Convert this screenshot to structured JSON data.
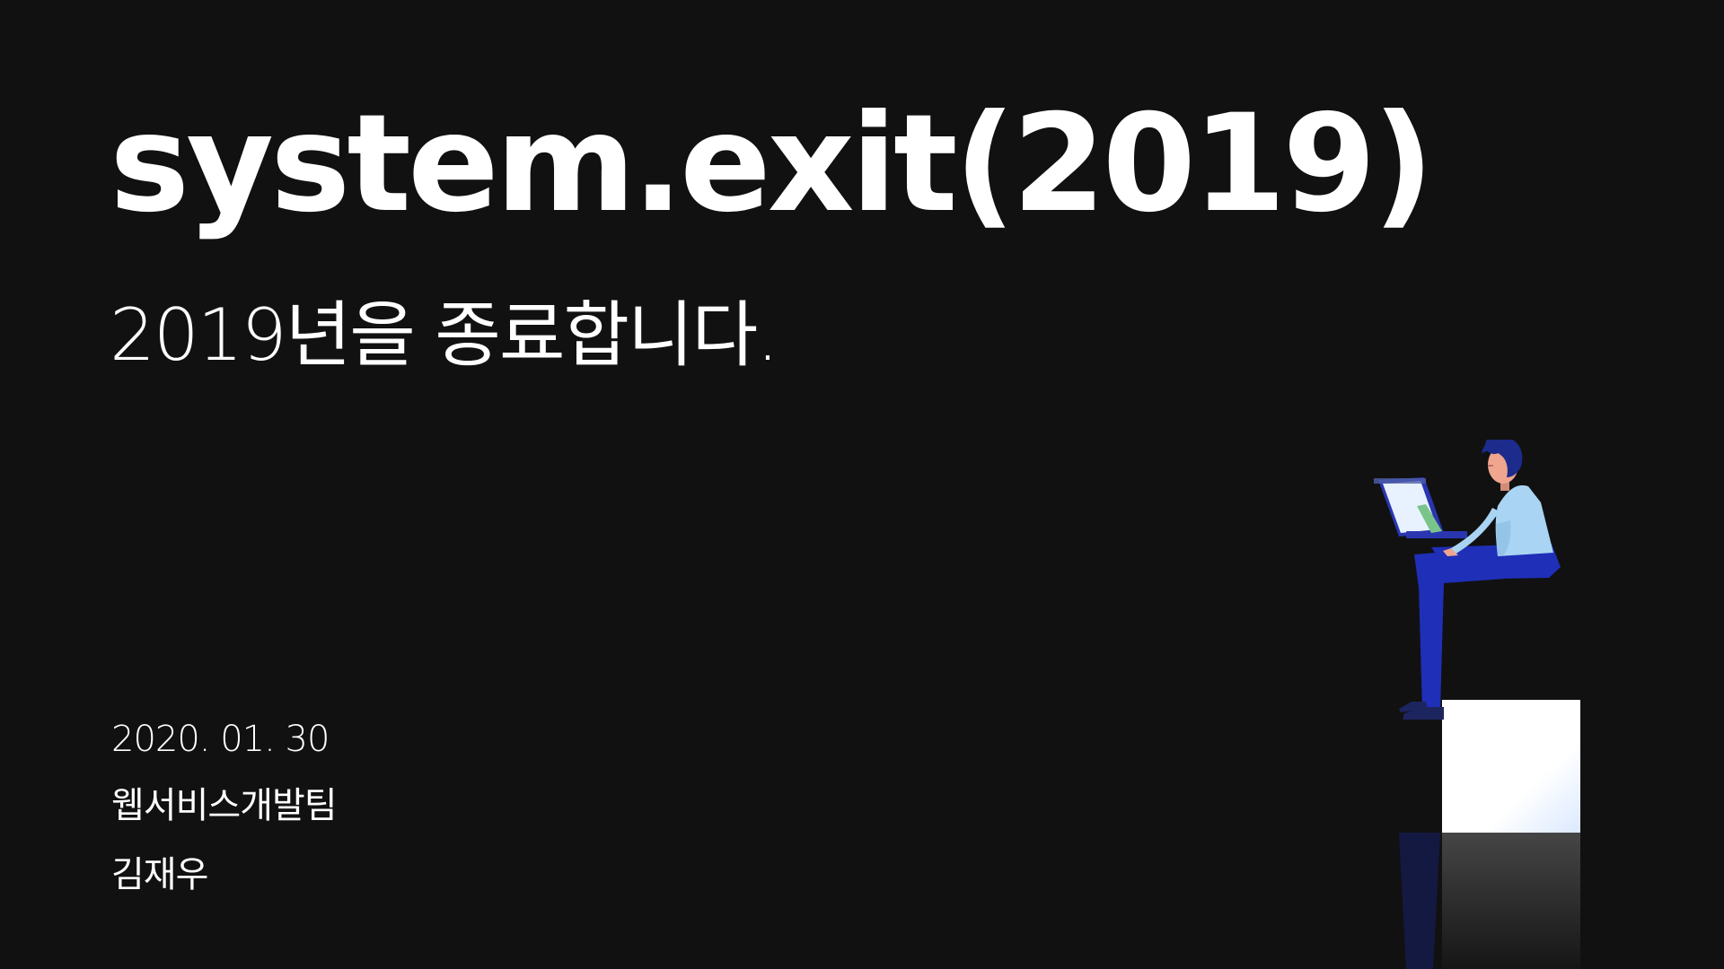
{
  "slide": {
    "title": "system.exit(2019)",
    "subtitle": "2019년을 종료합니다.",
    "date": "2020. 01. 30",
    "team": "웹서비스개발팀",
    "presenter": "김재우"
  },
  "illustration": {
    "icon": "person-working-on-laptop-icon",
    "colors": {
      "background": "#111111",
      "shirt": "#a9d4f3",
      "pants": "#1f2fb7",
      "hair": "#1c2b8c",
      "skin": "#f0a58f",
      "box": "#ffffff",
      "laptop": "#2a36b0",
      "laptop_screen": "#e8f2ff"
    }
  }
}
